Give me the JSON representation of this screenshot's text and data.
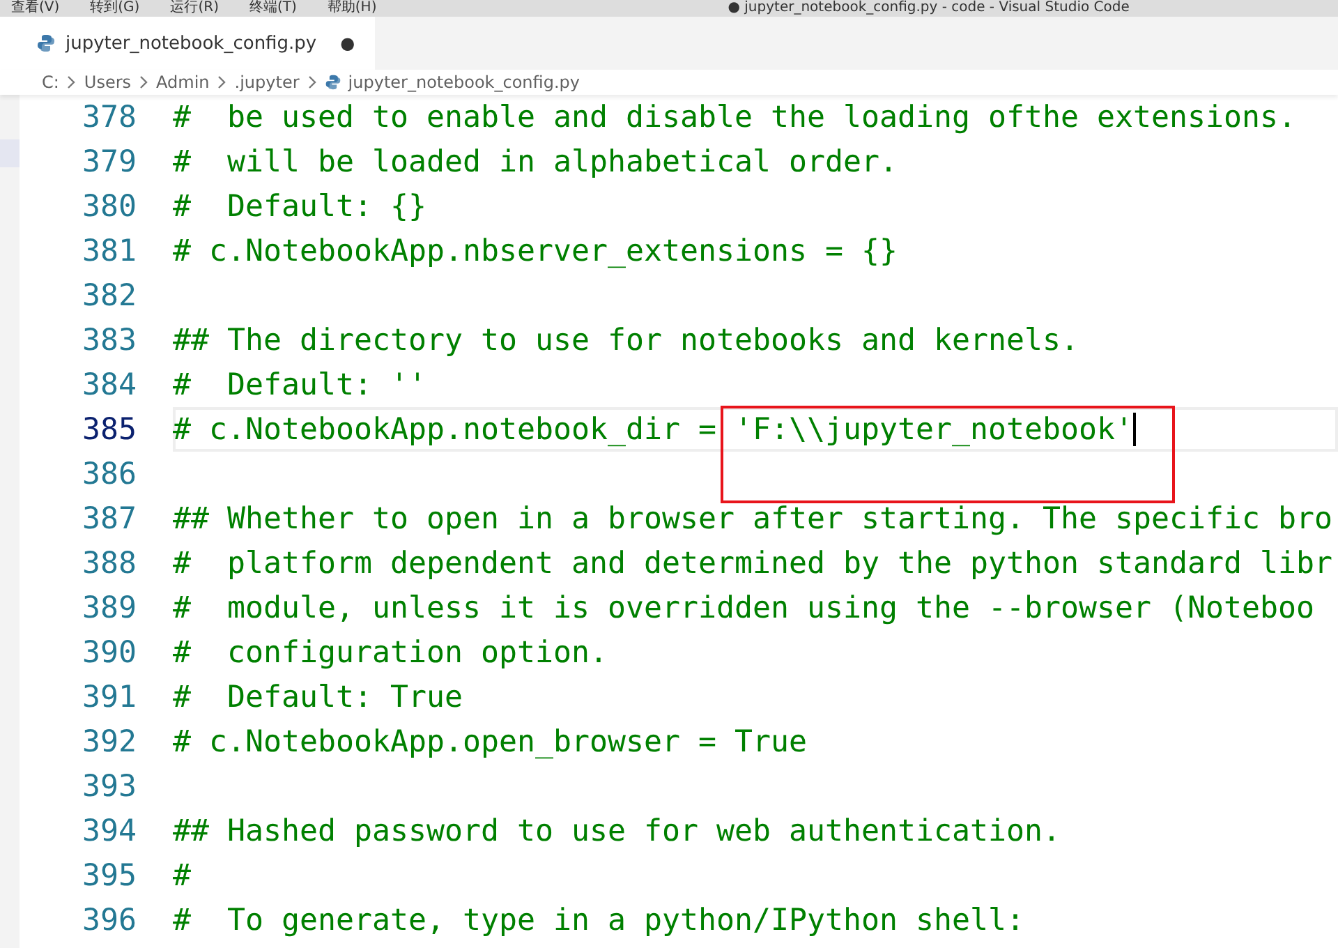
{
  "menu": [
    "查看(V)",
    "转到(G)",
    "运行(R)",
    "终端(T)",
    "帮助(H)"
  ],
  "window": {
    "title": "● jupyter_notebook_config.py - code - Visual Studio Code"
  },
  "tab": {
    "label": "jupyter_notebook_config.py",
    "modified": true,
    "dirty_mark": "●"
  },
  "breadcrumb": [
    {
      "label": "C:",
      "kind": "folder"
    },
    {
      "label": "Users",
      "kind": "folder"
    },
    {
      "label": "Admin",
      "kind": "folder"
    },
    {
      "label": ".jupyter",
      "kind": "folder"
    },
    {
      "label": "jupyter_notebook_config.py",
      "kind": "file"
    }
  ],
  "lines": [
    {
      "number": "378",
      "text": "#  be used to enable and disable the loading ofthe extensions.",
      "current": false,
      "boxed": false
    },
    {
      "number": "379",
      "text": "#  will be loaded in alphabetical order.",
      "current": false,
      "boxed": false
    },
    {
      "number": "380",
      "text": "#  Default: {}",
      "current": false,
      "boxed": false
    },
    {
      "number": "381",
      "text": "# c.NotebookApp.nbserver_extensions = {}",
      "current": false,
      "boxed": false
    },
    {
      "number": "382",
      "current": false,
      "boxed": false
    },
    {
      "number": "383",
      "text": "## The directory to use for notebooks and kernels.",
      "current": false,
      "boxed": false
    },
    {
      "number": "384",
      "text": "#  Default: ''",
      "current": false,
      "boxed": false
    },
    {
      "number": "385",
      "text": "# c.NotebookApp.notebook_dir = 'F:\\\\jupyter_notebook'",
      "current": true,
      "boxed": true
    },
    {
      "number": "386",
      "current": false,
      "boxed": false
    },
    {
      "number": "387",
      "text": "## Whether to open in a browser after starting. The specific bro",
      "current": false,
      "boxed": false
    },
    {
      "number": "388",
      "text": "#  platform dependent and determined by the python standard libr",
      "current": false,
      "boxed": false
    },
    {
      "number": "389",
      "text": "#  module, unless it is overridden using the --browser (Noteboo",
      "current": false,
      "boxed": false
    },
    {
      "number": "390",
      "text": "#  configuration option.",
      "current": false,
      "boxed": false
    },
    {
      "number": "391",
      "text": "#  Default: True",
      "current": false,
      "boxed": false
    },
    {
      "number": "392",
      "text": "# c.NotebookApp.open_browser = True",
      "current": false,
      "boxed": false
    },
    {
      "number": "393",
      "current": false,
      "boxed": false
    },
    {
      "number": "394",
      "text": "## Hashed password to use for web authentication.",
      "current": false,
      "boxed": false
    },
    {
      "number": "395",
      "text": "#",
      "current": false,
      "boxed": false
    },
    {
      "number": "396",
      "text": "#  To generate, type in a python/IPython shell:",
      "current": false,
      "boxed": false
    }
  ]
}
